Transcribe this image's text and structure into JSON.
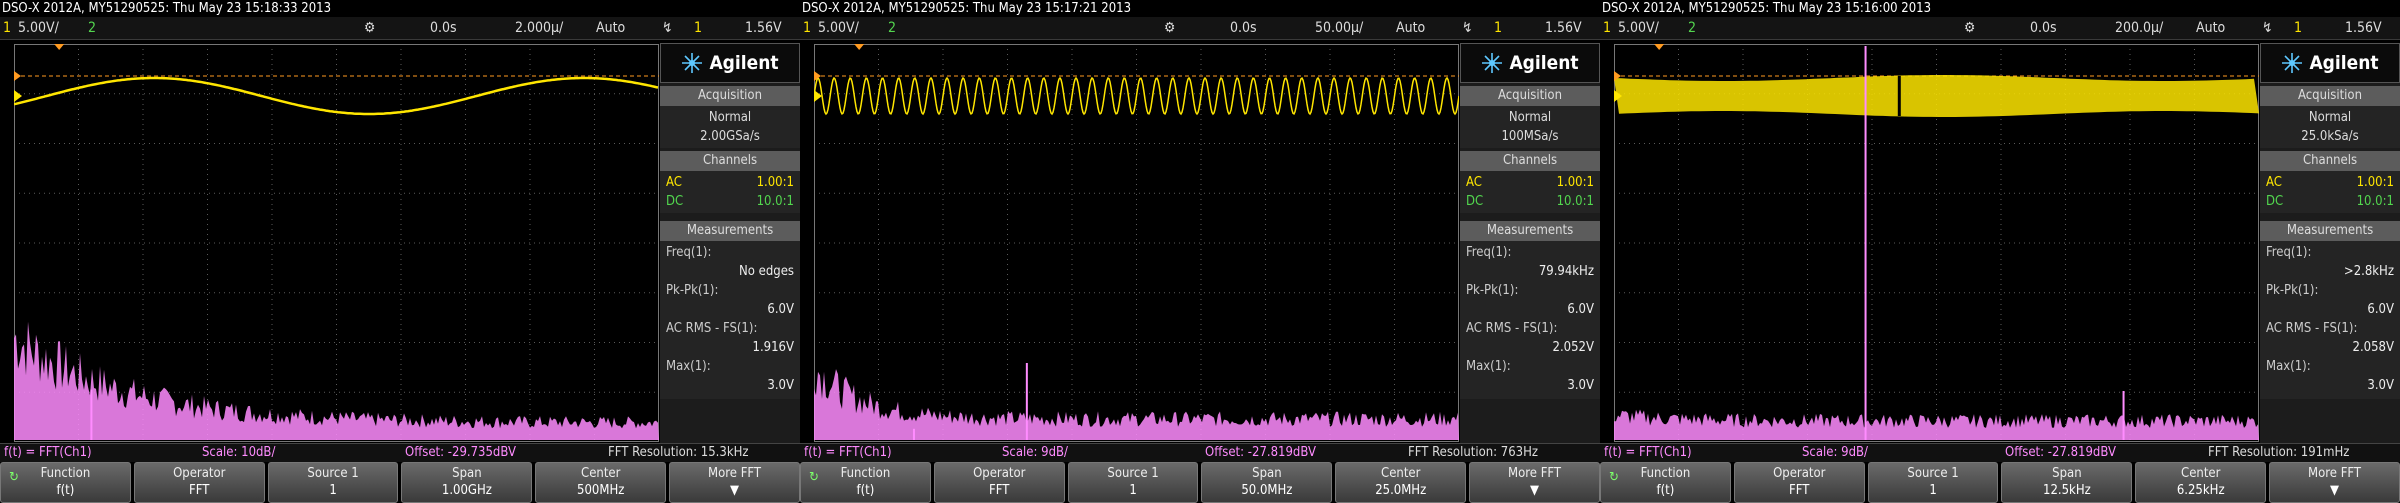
{
  "screens": [
    {
      "title": "DSO-X 2012A, MY51290525: Thu May 23 15:18:33 2013",
      "status": {
        "ch1": "1",
        "ch1_scale": "5.00V/",
        "ch2": "2",
        "delay": "0.0s",
        "timebase": "2.000µ/",
        "trig_mode": "Auto",
        "trig_src": "1",
        "trig_level": "1.56V"
      },
      "acq_mode": "Normal",
      "acq_rate": "2.00GSa/s",
      "ch_ac": "AC",
      "ch_ac_ratio": "1.00:1",
      "ch_dc": "DC",
      "ch_dc_ratio": "10.0:1",
      "freq_val": "No edges",
      "pkpk_val": "6.0V",
      "acrms_val": "1.916V",
      "max_val": "3.0V",
      "minfo": {
        "func": "f(t) = FFT(Ch1)",
        "scale": "Scale: 10dB/",
        "offset": "Offset: -29.735dBV",
        "res": "FFT Resolution: 15.3kHz"
      },
      "keys": {
        "span": "1.00GHz",
        "center": "500MHz"
      },
      "signal": "sine",
      "spikes": [
        {
          "pos": 0.12,
          "h": 0.36
        }
      ]
    },
    {
      "title": "DSO-X 2012A, MY51290525: Thu May 23 15:17:21 2013",
      "status": {
        "ch1": "1",
        "ch1_scale": "5.00V/",
        "ch2": "2",
        "delay": "0.0s",
        "timebase": "50.00µ/",
        "trig_mode": "Auto",
        "trig_src": "1",
        "trig_level": "1.56V"
      },
      "acq_mode": "Normal",
      "acq_rate": "100MSa/s",
      "ch_ac": "AC",
      "ch_ac_ratio": "1.00:1",
      "ch_dc": "DC",
      "ch_dc_ratio": "10.0:1",
      "freq_val": "79.94kHz",
      "pkpk_val": "6.0V",
      "acrms_val": "2.052V",
      "max_val": "3.0V",
      "minfo": {
        "func": "f(t) = FFT(Ch1)",
        "scale": "Scale: 9dB/",
        "offset": "Offset: -27.819dBV",
        "res": "FFT Resolution: 763Hz"
      },
      "keys": {
        "span": "50.0MHz",
        "center": "25.0MHz"
      },
      "signal": "dense",
      "spikes": [
        {
          "pos": 0.33,
          "h": 0.55
        },
        {
          "pos": 0.155,
          "h": 0.08
        }
      ]
    },
    {
      "title": "DSO-X 2012A, MY51290525: Thu May 23 15:16:00 2013",
      "status": {
        "ch1": "1",
        "ch1_scale": "5.00V/",
        "ch2": "2",
        "delay": "0.0s",
        "timebase": "200.0µ/",
        "trig_mode": "Auto",
        "trig_src": "1",
        "trig_level": "1.56V"
      },
      "acq_mode": "Normal",
      "acq_rate": "25.0kSa/s",
      "ch_ac": "AC",
      "ch_ac_ratio": "1.00:1",
      "ch_dc": "DC",
      "ch_dc_ratio": "10.0:1",
      "freq_val": ">2.8kHz",
      "pkpk_val": "6.0V",
      "acrms_val": "2.058V",
      "max_val": "3.0V",
      "minfo": {
        "func": "f(t) = FFT(Ch1)",
        "scale": "Scale: 9dB/",
        "offset": "Offset: -27.819dBV",
        "res": "FFT Resolution: 191mHz"
      },
      "keys": {
        "span": "12.5kHz",
        "center": "6.25kHz"
      },
      "signal": "band",
      "spikes": [
        {
          "pos": 0.39,
          "h": 2.9
        },
        {
          "pos": 0.79,
          "h": 0.35
        }
      ]
    }
  ],
  "labels": {
    "brand": "Agilent",
    "acquisition": "Acquisition",
    "channels": "Channels",
    "measurements": "Measurements",
    "freq": "Freq(1):",
    "pkpk": "Pk-Pk(1):",
    "acrms": "AC RMS - FS(1):",
    "max": "Max(1):",
    "key_function": "Function",
    "key_function_val": "f(t)",
    "key_operator": "Operator",
    "key_operator_val": "FFT",
    "key_source": "Source 1",
    "key_source_val": "1",
    "key_span": "Span",
    "key_center": "Center",
    "key_more": "More FFT"
  },
  "colors": {
    "ch1": "#ffe600",
    "ch2": "#52d64e",
    "math": "#ff8cff",
    "grid": "#5a5a5a",
    "trigger": "#ff9a20"
  }
}
